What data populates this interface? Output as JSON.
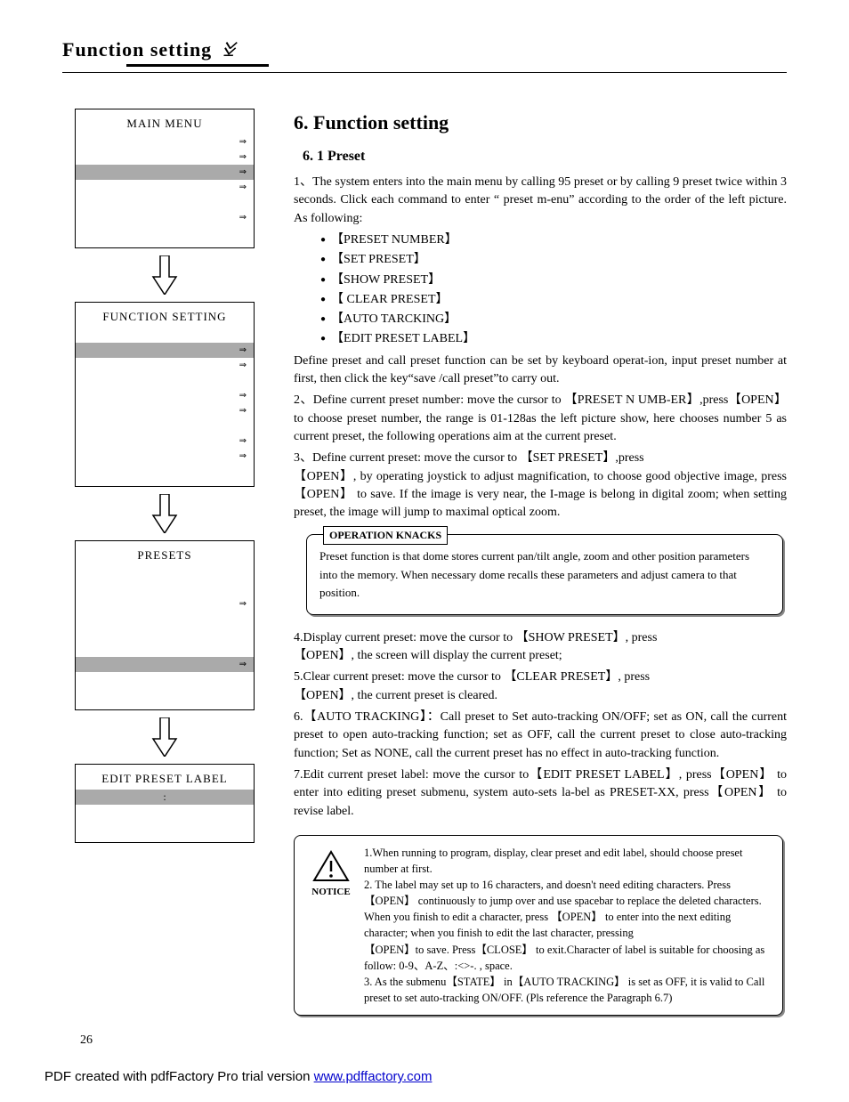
{
  "header": {
    "title": "Function setting"
  },
  "menus": {
    "main": {
      "title": "MAIN  MENU",
      "rows": [
        {
          "arrow": true,
          "highlight": false
        },
        {
          "arrow": true,
          "highlight": false
        },
        {
          "arrow": true,
          "highlight": true
        },
        {
          "arrow": true,
          "highlight": false
        },
        {
          "arrow": false,
          "highlight": false
        },
        {
          "arrow": true,
          "highlight": false
        },
        {
          "arrow": false,
          "highlight": false
        }
      ]
    },
    "function": {
      "title": "FUNCTION  SETTING",
      "rows": [
        {
          "arrow": false,
          "highlight": false
        },
        {
          "arrow": true,
          "highlight": true
        },
        {
          "arrow": true,
          "highlight": false
        },
        {
          "arrow": false,
          "highlight": false
        },
        {
          "arrow": true,
          "highlight": false
        },
        {
          "arrow": true,
          "highlight": false
        },
        {
          "arrow": false,
          "highlight": false
        },
        {
          "arrow": true,
          "highlight": false
        },
        {
          "arrow": true,
          "highlight": false
        },
        {
          "arrow": false,
          "highlight": false
        }
      ]
    },
    "presets": {
      "title": "PRESETS",
      "rows": [
        {
          "arrow": false,
          "highlight": false
        },
        {
          "arrow": false,
          "highlight": false
        },
        {
          "arrow": true,
          "highlight": false
        },
        {
          "arrow": false,
          "highlight": false
        },
        {
          "arrow": false,
          "highlight": false
        },
        {
          "arrow": false,
          "highlight": false
        },
        {
          "arrow": true,
          "highlight": true
        },
        {
          "arrow": false,
          "highlight": false
        },
        {
          "arrow": false,
          "highlight": false
        }
      ]
    },
    "edit": {
      "title": "EDIT  PRESET  LABEL",
      "rows": [
        {
          "text": ":",
          "highlight": true
        },
        {
          "highlight": false
        },
        {
          "highlight": false
        }
      ]
    }
  },
  "content": {
    "h1": "6.  Function setting",
    "h2": "6.  1   Preset",
    "p1": "1、The system enters into the main menu by calling 95 preset or by calling 9 preset twice within 3 seconds. Click each command to enter “ preset m-enu” according to the order of the left picture.  As following:",
    "bullets": [
      "【PRESET NUMBER】",
      "【SET PRESET】",
      "【SHOW PRESET】",
      "【 CLEAR PRESET】",
      "【AUTO TARCKING】",
      "【EDIT  PRESET LABEL】"
    ],
    "p_define": "  Define preset and call preset function can be set by keyboard operat-ion, input preset number at first, then click the key“save /call preset”to carry out.",
    "p2": "2、Define current preset number: move the cursor to 【PRESET N  UMB-ER】,press【OPEN】 to choose preset number, the range is 01-128as the left picture show, here chooses number 5 as current preset, the following operations aim at the current preset.",
    "p3": "3、Define current preset: move the cursor to 【SET PRESET】,press\n【OPEN】, by operating joystick to adjust magnification, to choose good objective image, press  【OPEN】 to save. If the image is very near, the I-mage is belong in digital zoom; when setting preset, the image will jump to  maximal optical zoom.",
    "knacks_label": "OPERATION KNACKS",
    "knacks": "      Preset function is that dome stores current pan/tilt angle, zoom and other position parameters into the memory. When necessary dome recalls these parameters and adjust camera to that position.",
    "p4": "4.Display current preset: move the cursor to 【SHOW PRESET】, press\n【OPEN】, the screen will display the current preset;",
    "p5": "5.Clear current preset: move the cursor to 【CLEAR PRESET】, press\n【OPEN】, the current preset is cleared.",
    "p6": "6.【AUTO TRACKING】：Call preset to Set auto-tracking ON/OFF; set as ON, call the current preset to open auto-tracking function; set as OFF, call the current preset to close auto-tracking function; Set as NONE, call  the current preset has no effect in auto-tracking function.",
    "p7": "7.Edit current preset label: move the cursor to【EDIT PRESET  LABEL】, press【OPEN】 to enter into editing preset submenu, system auto-sets la-bel as PRESET-XX, press【OPEN】 to revise label.",
    "notice_label": "NOTICE",
    "notice": "1.When running to program, display, clear preset and edit label, should choose preset number at first.\n2. The label may set up to 16 characters, and doesn't need editing characters. Press 【OPEN】 continuously to jump over and use spacebar to replace the deleted characters. When you finish to edit a character, press 【OPEN】 to enter into the next editing character;  when you finish to edit the last character, pressing\n【OPEN】to save. Press【CLOSE】 to exit.Character of label is suitable for choosing as follow: 0-9、A-Z、:<>-. , space.\n3. As the submenu【STATE】 in【AUTO TRACKING】 is set as OFF, it is valid to Call preset to set auto-tracking ON/OFF. (Pls reference the Paragraph 6.7)"
  },
  "page_number": "26",
  "footer": {
    "text": "PDF created with pdfFactory Pro trial version ",
    "link_text": "www.pdffactory.com"
  }
}
